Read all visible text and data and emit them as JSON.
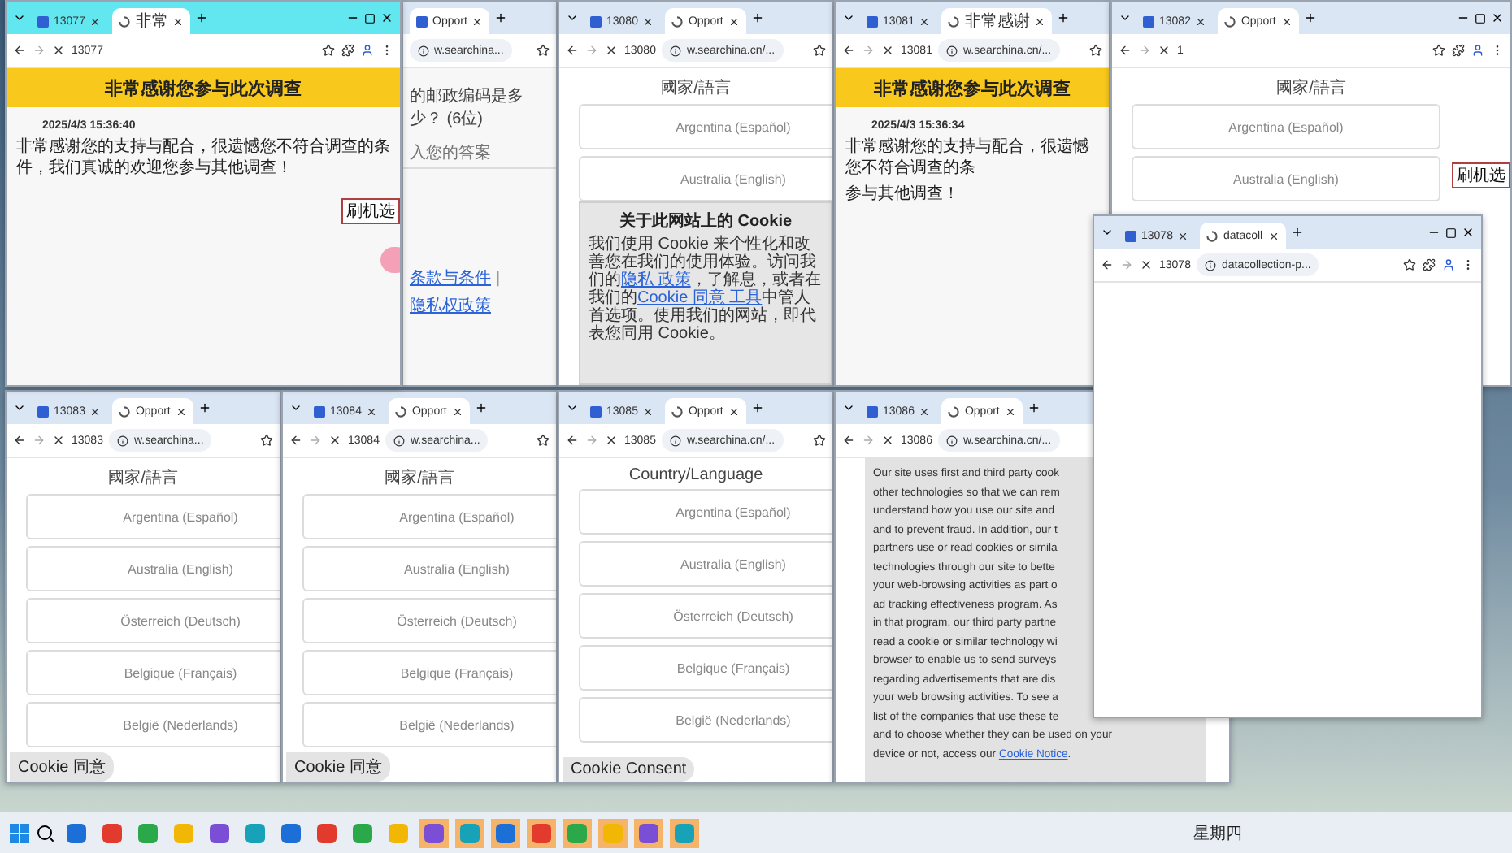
{
  "windows": [
    {
      "active": true,
      "tab_menu": true,
      "controls": true,
      "tabs": [
        {
          "label": "13077",
          "selected": false
        },
        {
          "label": "非常",
          "selected": true
        }
      ],
      "address": {
        "nav": true,
        "tab_id": "13077",
        "full_toolbar": true
      },
      "content": {
        "kind": "thanks",
        "banner": "非常感谢您参与此次调查",
        "date": "2025/4/3 15:36:40",
        "lines": [
          "非常感谢您的支持与配合，很遗憾您不符合调查的条件，我们真诚的欢迎您参与其他调查！"
        ],
        "side_label": "刷机选",
        "float_button": true
      }
    },
    {
      "active": false,
      "tabs": [
        {
          "label": "Opport",
          "selected": true
        }
      ],
      "address": {
        "url": "w.searchina..."
      },
      "content": {
        "kind": "survey",
        "question": "的邮政编码是多少？ (6位)",
        "placeholder": "入您的答案",
        "links": [
          "条款与条件",
          "隐私权政策"
        ],
        "separator": "|"
      }
    },
    {
      "active": false,
      "tab_menu": true,
      "tabs": [
        {
          "label": "13080",
          "selected": false
        },
        {
          "label": "Opport",
          "selected": true
        }
      ],
      "address": {
        "nav": true,
        "tab_id": "13080",
        "url": "w.searchina.cn/..."
      },
      "content": {
        "kind": "countries",
        "heading": "國家/語言",
        "options": [
          "Argentina (Español)",
          "Australia (English)"
        ],
        "popup": {
          "kind": "cn",
          "title": "关于此网站上的 Cookie",
          "segments": [
            {
              "kind": "text",
              "text": "我们使用 Cookie 来个性化和改善您在我们的使用体验。访问我们的"
            },
            {
              "kind": "link",
              "text": "隐私 政策"
            },
            {
              "kind": "text",
              "text": "，了解息，或者在我们的"
            },
            {
              "kind": "link",
              "text": "Cookie 同意 工具"
            },
            {
              "kind": "text",
              "text": "中管人首选项。使用我们的网站，即代表您同用 Cookie。"
            }
          ]
        }
      }
    },
    {
      "active": false,
      "tab_menu": true,
      "tabs": [
        {
          "label": "13081",
          "selected": false
        },
        {
          "label": "非常感谢",
          "selected": true
        }
      ],
      "address": {
        "nav": true,
        "tab_id": "13081",
        "url": "w.searchina.cn/..."
      },
      "content": {
        "kind": "thanks",
        "banner": "非常感谢您参与此次调查",
        "date": "2025/4/3 15:36:34",
        "lines": [
          "非常感谢您的支持与配合，很遗憾您不符合调查的条",
          "参与其他调查！"
        ]
      }
    },
    {
      "active": false,
      "tab_menu": true,
      "controls": true,
      "tabs": [
        {
          "label": "13082",
          "selected": false
        },
        {
          "label": "Opport",
          "selected": true
        }
      ],
      "address": {
        "nav": true,
        "tab_id": "1",
        "full_toolbar": true
      },
      "content": {
        "kind": "countries",
        "heading": "國家/語言",
        "options": [
          "Argentina (Español)",
          "Australia (English)"
        ],
        "side_label": "刷机选"
      }
    },
    {
      "active": false,
      "tab_menu": true,
      "controls": true,
      "tabs": [
        {
          "label": "13078",
          "selected": false
        },
        {
          "label": "datacoll",
          "selected": true
        }
      ],
      "address": {
        "nav": true,
        "tab_id": "13078",
        "url": "datacollection-p...",
        "full_toolbar": true
      },
      "content": {
        "kind": "blank"
      }
    },
    {
      "active": false,
      "tab_menu": true,
      "tabs": [
        {
          "label": "13083",
          "selected": false
        },
        {
          "label": "Opport",
          "selected": true
        }
      ],
      "address": {
        "nav": true,
        "tab_id": "13083",
        "url": "w.searchina..."
      },
      "content": {
        "kind": "countries",
        "heading": "國家/語言",
        "options": [
          "Argentina (Español)",
          "Australia (English)",
          "Österreich (Deutsch)",
          "Belgique (Français)",
          "België (Nederlands)"
        ],
        "cookie_button": "Cookie 同意"
      }
    },
    {
      "active": false,
      "tab_menu": true,
      "tabs": [
        {
          "label": "13084",
          "selected": false
        },
        {
          "label": "Opport",
          "selected": true
        }
      ],
      "address": {
        "nav": true,
        "tab_id": "13084",
        "url": "w.searchina..."
      },
      "content": {
        "kind": "countries",
        "heading": "國家/語言",
        "options": [
          "Argentina (Español)",
          "Australia (English)",
          "Österreich (Deutsch)",
          "Belgique (Français)",
          "België (Nederlands)"
        ],
        "cookie_button": "Cookie 同意"
      }
    },
    {
      "active": false,
      "tab_menu": true,
      "tabs": [
        {
          "label": "13085",
          "selected": false
        },
        {
          "label": "Opport",
          "selected": true
        }
      ],
      "address": {
        "nav": true,
        "tab_id": "13085",
        "url": "w.searchina.cn/..."
      },
      "content": {
        "kind": "countries",
        "heading": "Country/Language",
        "options": [
          "Argentina (Español)",
          "Australia (English)",
          "Österreich (Deutsch)",
          "Belgique (Français)",
          "België (Nederlands)"
        ],
        "cookie_button": "Cookie Consent"
      }
    },
    {
      "active": false,
      "tab_menu": true,
      "tabs": [
        {
          "label": "13086",
          "selected": false
        },
        {
          "label": "Opport",
          "selected": true
        }
      ],
      "address": {
        "nav": true,
        "tab_id": "13086",
        "url": "w.searchina.cn/..."
      },
      "content": {
        "kind": "countries",
        "popup": {
          "kind": "en",
          "lines": [
            "Our site uses first and third party cook",
            "other technologies so that we can rem",
            "understand how you use our site and",
            "and to prevent fraud. In addition, our t",
            "partners use or read cookies or simila",
            "technologies through our site to bette",
            "your web-browsing activities as part o",
            "ad tracking effectiveness program. As",
            "in that program, our third party partne",
            "read a cookie or similar technology wi",
            "browser to enable us to send surveys",
            "regarding advertisements that are dis",
            "your web browsing activities. To see a",
            "list of the companies that use these te",
            "and to choose whether they can be used on your",
            "device or not, access our"
          ],
          "link": "Cookie Notice",
          "end": "."
        }
      }
    }
  ],
  "taskbar": {
    "apps": [
      {
        "active": false
      },
      {
        "active": false
      },
      {
        "active": false
      },
      {
        "active": false
      },
      {
        "active": false
      },
      {
        "active": false
      },
      {
        "active": false
      },
      {
        "active": false
      },
      {
        "active": false
      },
      {
        "active": false
      },
      {
        "active": true
      },
      {
        "active": true
      },
      {
        "active": true
      },
      {
        "active": true
      },
      {
        "active": true
      },
      {
        "active": true
      },
      {
        "active": true
      },
      {
        "active": true
      }
    ],
    "day": "星期四"
  }
}
